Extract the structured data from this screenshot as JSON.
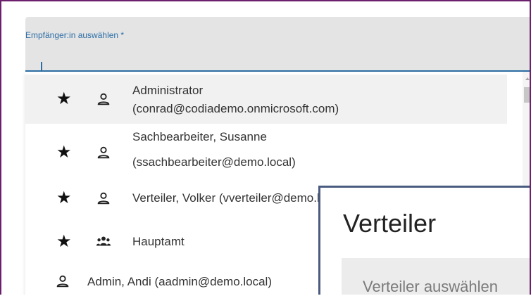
{
  "field": {
    "label": "Empfänger:in auswählen *"
  },
  "dropdown": {
    "items": [
      {
        "label_line1": "Administrator",
        "label_line2": "(conrad@codiademo.onmicrosoft.com)",
        "favorite": true,
        "icon": "person-icon"
      },
      {
        "label_line1": "Sachbearbeiter, Susanne",
        "label_line2": "(ssachbearbeiter@demo.local)",
        "favorite": true,
        "icon": "person-icon"
      },
      {
        "label_line1": "Verteiler, Volker (vverteiler@demo.local)",
        "favorite": true,
        "icon": "person-icon"
      },
      {
        "label_line1": "Hauptamt",
        "favorite": true,
        "icon": "group-icon"
      },
      {
        "label_line1": "Admin, Andi (aadmin@demo.local)",
        "favorite": false,
        "icon": "person-icon"
      }
    ]
  },
  "overlay": {
    "title": "Verteiler",
    "placeholder": "Verteiler auswählen"
  },
  "colors": {
    "accent": "#2c6ea5",
    "frame": "#6b1f6d",
    "overlay_border": "#4b5b80"
  }
}
